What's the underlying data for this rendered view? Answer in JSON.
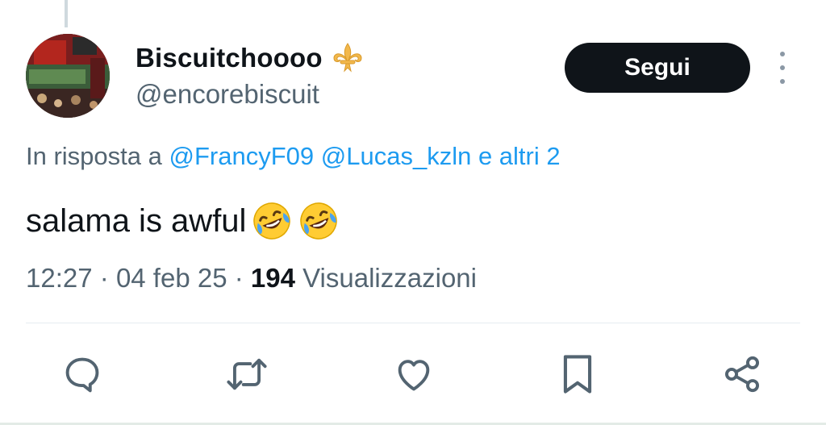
{
  "tweet": {
    "display_name": "Biscuitchoooo",
    "badge_icon": "fleur-de-lis-icon",
    "handle": "@encorebiscuit",
    "follow_label": "Segui",
    "reply_prefix": "In risposta a",
    "reply_mentions": [
      "@FrancyF09",
      "@Lucas_kzln"
    ],
    "reply_suffix": "e altri 2",
    "text": "salama is awful",
    "emojis": [
      "rolling-on-floor-laughing-icon",
      "rolling-on-floor-laughing-icon"
    ],
    "time": "12:27",
    "date": "04 feb 25",
    "separator": "·",
    "views_count": "194",
    "views_label": "Visualizzazioni"
  },
  "actions": [
    {
      "name": "reply-icon"
    },
    {
      "name": "retweet-icon"
    },
    {
      "name": "like-icon"
    },
    {
      "name": "bookmark-icon"
    },
    {
      "name": "share-icon"
    }
  ],
  "colors": {
    "text_primary": "#0f1419",
    "text_secondary": "#536471",
    "link": "#1d9bf0",
    "follow_bg": "#0f1419",
    "badge_gold": "#f2b84b"
  }
}
